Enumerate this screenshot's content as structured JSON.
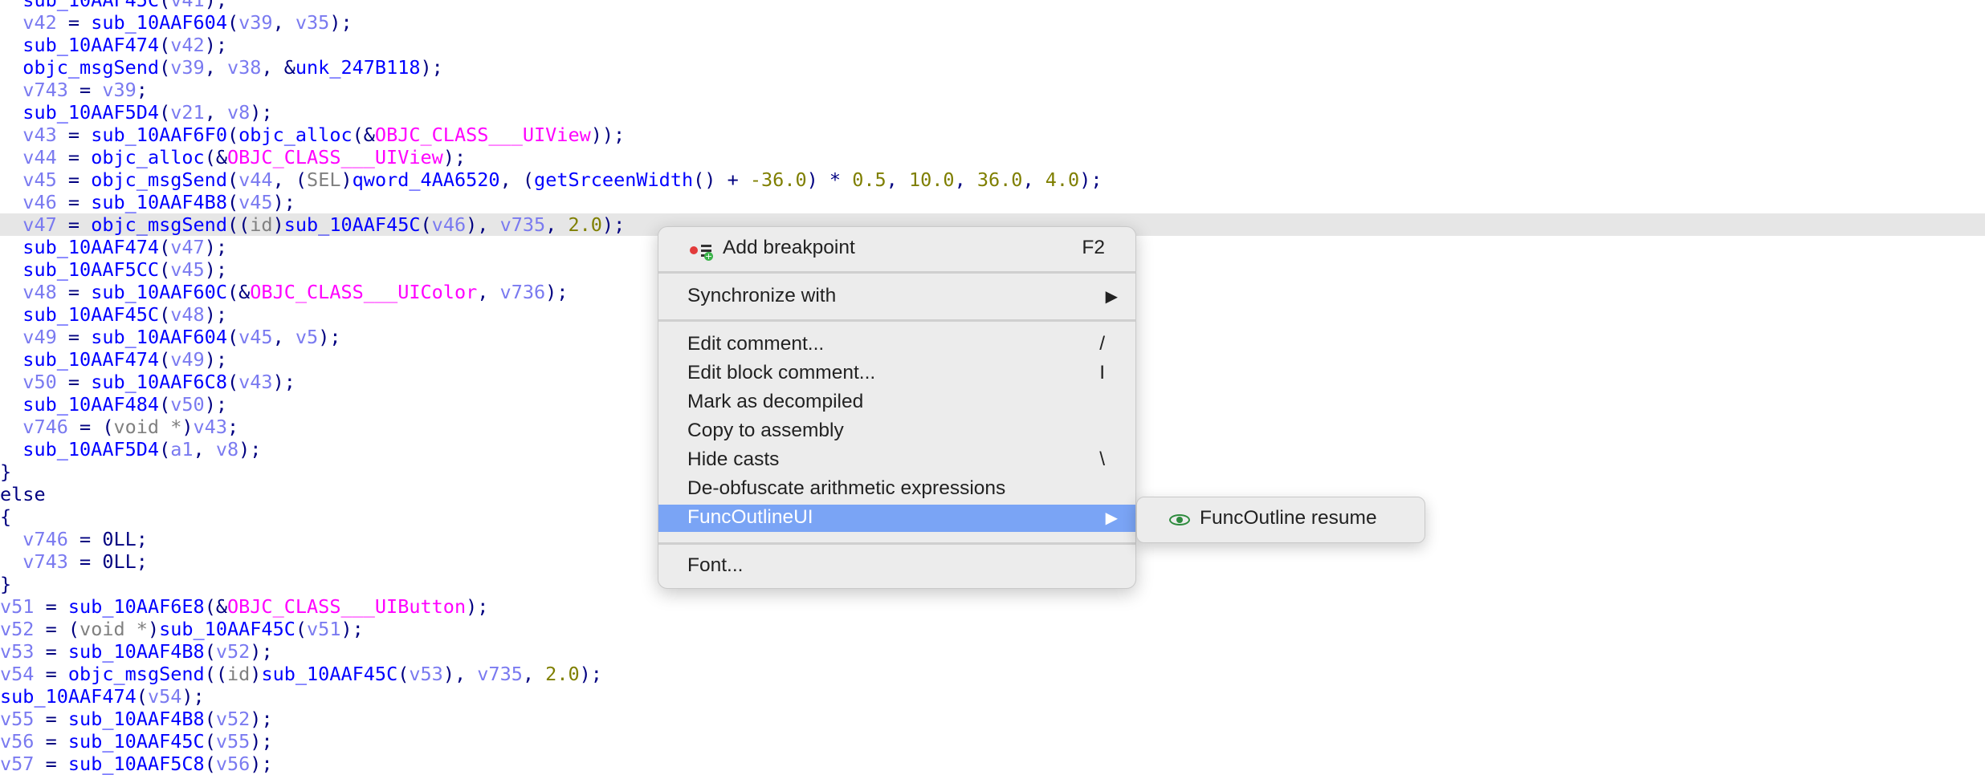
{
  "code": {
    "highlighted_line": 10,
    "lines": [
      [
        [
          "  ",
          "pun"
        ],
        [
          "sub_10AAF45C",
          "fn"
        ],
        [
          "(",
          "pun"
        ],
        [
          "v41",
          "var"
        ],
        [
          ");",
          "pun"
        ]
      ],
      [
        [
          "  ",
          "pun"
        ],
        [
          "v42",
          "var"
        ],
        [
          " = ",
          "op"
        ],
        [
          "sub_10AAF604",
          "fn"
        ],
        [
          "(",
          "pun"
        ],
        [
          "v39",
          "var"
        ],
        [
          ", ",
          "pun"
        ],
        [
          "v35",
          "var"
        ],
        [
          ");",
          "pun"
        ]
      ],
      [
        [
          "  ",
          "pun"
        ],
        [
          "sub_10AAF474",
          "fn"
        ],
        [
          "(",
          "pun"
        ],
        [
          "v42",
          "var"
        ],
        [
          ");",
          "pun"
        ]
      ],
      [
        [
          "  ",
          "pun"
        ],
        [
          "objc_msgSend",
          "fn"
        ],
        [
          "(",
          "pun"
        ],
        [
          "v39",
          "var"
        ],
        [
          ", ",
          "pun"
        ],
        [
          "v38",
          "var"
        ],
        [
          ", &",
          "pun"
        ],
        [
          "unk_247B118",
          "fn"
        ],
        [
          ");",
          "pun"
        ]
      ],
      [
        [
          "  ",
          "pun"
        ],
        [
          "v743",
          "var"
        ],
        [
          " = ",
          "op"
        ],
        [
          "v39",
          "var"
        ],
        [
          ";",
          "pun"
        ]
      ],
      [
        [
          "  ",
          "pun"
        ],
        [
          "sub_10AAF5D4",
          "fn"
        ],
        [
          "(",
          "pun"
        ],
        [
          "v21",
          "var"
        ],
        [
          ", ",
          "pun"
        ],
        [
          "v8",
          "var"
        ],
        [
          ");",
          "pun"
        ]
      ],
      [
        [
          "  ",
          "pun"
        ],
        [
          "v43",
          "var"
        ],
        [
          " = ",
          "op"
        ],
        [
          "sub_10AAF6F0",
          "fn"
        ],
        [
          "(",
          "pun"
        ],
        [
          "objc_alloc",
          "fn"
        ],
        [
          "(&",
          "pun"
        ],
        [
          "OBJC_CLASS___UIView",
          "cls"
        ],
        [
          "));",
          "pun"
        ]
      ],
      [
        [
          "  ",
          "pun"
        ],
        [
          "v44",
          "var"
        ],
        [
          " = ",
          "op"
        ],
        [
          "objc_alloc",
          "fn"
        ],
        [
          "(&",
          "pun"
        ],
        [
          "OBJC_CLASS___UIView",
          "cls"
        ],
        [
          ");",
          "pun"
        ]
      ],
      [
        [
          "  ",
          "pun"
        ],
        [
          "v45",
          "var"
        ],
        [
          " = ",
          "op"
        ],
        [
          "objc_msgSend",
          "fn"
        ],
        [
          "(",
          "pun"
        ],
        [
          "v44",
          "var"
        ],
        [
          ", (",
          "pun"
        ],
        [
          "SEL",
          "typ"
        ],
        [
          ")",
          "pun"
        ],
        [
          "qword_4AA6520",
          "fn"
        ],
        [
          ", (",
          "pun"
        ],
        [
          "getSrceenWidth",
          "fn"
        ],
        [
          "() + ",
          "pun"
        ],
        [
          "-36.0",
          "num"
        ],
        [
          ") * ",
          "pun"
        ],
        [
          "0.5",
          "num"
        ],
        [
          ", ",
          "pun"
        ],
        [
          "10.0",
          "num"
        ],
        [
          ", ",
          "pun"
        ],
        [
          "36.0",
          "num"
        ],
        [
          ", ",
          "pun"
        ],
        [
          "4.0",
          "num"
        ],
        [
          ");",
          "pun"
        ]
      ],
      [
        [
          "  ",
          "pun"
        ],
        [
          "v46",
          "var"
        ],
        [
          " = ",
          "op"
        ],
        [
          "sub_10AAF4B8",
          "fn"
        ],
        [
          "(",
          "pun"
        ],
        [
          "v45",
          "var"
        ],
        [
          ");",
          "pun"
        ]
      ],
      [
        [
          "  ",
          "pun"
        ],
        [
          "v47",
          "var"
        ],
        [
          " = ",
          "op"
        ],
        [
          "objc_msgSend",
          "fn"
        ],
        [
          "((",
          "pun"
        ],
        [
          "id",
          "typ"
        ],
        [
          ")",
          "pun"
        ],
        [
          "sub_10AAF45C",
          "fn"
        ],
        [
          "(",
          "pun"
        ],
        [
          "v46",
          "var"
        ],
        [
          "), ",
          "pun"
        ],
        [
          "v735",
          "var"
        ],
        [
          ", ",
          "pun"
        ],
        [
          "2.0",
          "num"
        ],
        [
          ");",
          "pun"
        ]
      ],
      [
        [
          "  ",
          "pun"
        ],
        [
          "sub_10AAF474",
          "fn"
        ],
        [
          "(",
          "pun"
        ],
        [
          "v47",
          "var"
        ],
        [
          ");",
          "pun"
        ]
      ],
      [
        [
          "  ",
          "pun"
        ],
        [
          "sub_10AAF5CC",
          "fn"
        ],
        [
          "(",
          "pun"
        ],
        [
          "v45",
          "var"
        ],
        [
          ");",
          "pun"
        ]
      ],
      [
        [
          "  ",
          "pun"
        ],
        [
          "v48",
          "var"
        ],
        [
          " = ",
          "op"
        ],
        [
          "sub_10AAF60C",
          "fn"
        ],
        [
          "(&",
          "pun"
        ],
        [
          "OBJC_CLASS___UIColor",
          "cls"
        ],
        [
          ", ",
          "pun"
        ],
        [
          "v736",
          "var"
        ],
        [
          ");",
          "pun"
        ]
      ],
      [
        [
          "  ",
          "pun"
        ],
        [
          "sub_10AAF45C",
          "fn"
        ],
        [
          "(",
          "pun"
        ],
        [
          "v48",
          "var"
        ],
        [
          ");",
          "pun"
        ]
      ],
      [
        [
          "  ",
          "pun"
        ],
        [
          "v49",
          "var"
        ],
        [
          " = ",
          "op"
        ],
        [
          "sub_10AAF604",
          "fn"
        ],
        [
          "(",
          "pun"
        ],
        [
          "v45",
          "var"
        ],
        [
          ", ",
          "pun"
        ],
        [
          "v5",
          "var"
        ],
        [
          ");",
          "pun"
        ]
      ],
      [
        [
          "  ",
          "pun"
        ],
        [
          "sub_10AAF474",
          "fn"
        ],
        [
          "(",
          "pun"
        ],
        [
          "v49",
          "var"
        ],
        [
          ");",
          "pun"
        ]
      ],
      [
        [
          "  ",
          "pun"
        ],
        [
          "v50",
          "var"
        ],
        [
          " = ",
          "op"
        ],
        [
          "sub_10AAF6C8",
          "fn"
        ],
        [
          "(",
          "pun"
        ],
        [
          "v43",
          "var"
        ],
        [
          ");",
          "pun"
        ]
      ],
      [
        [
          "  ",
          "pun"
        ],
        [
          "sub_10AAF484",
          "fn"
        ],
        [
          "(",
          "pun"
        ],
        [
          "v50",
          "var"
        ],
        [
          ");",
          "pun"
        ]
      ],
      [
        [
          "  ",
          "pun"
        ],
        [
          "v746",
          "var"
        ],
        [
          " = (",
          "op"
        ],
        [
          "void *",
          "typ"
        ],
        [
          ")",
          "pun"
        ],
        [
          "v43",
          "var"
        ],
        [
          ";",
          "pun"
        ]
      ],
      [
        [
          "  ",
          "pun"
        ],
        [
          "sub_10AAF5D4",
          "fn"
        ],
        [
          "(",
          "pun"
        ],
        [
          "a1",
          "var"
        ],
        [
          ", ",
          "pun"
        ],
        [
          "v8",
          "var"
        ],
        [
          ");",
          "pun"
        ]
      ],
      [
        [
          "}",
          "pun"
        ]
      ],
      [
        [
          "else",
          "kw"
        ]
      ],
      [
        [
          "{",
          "pun"
        ]
      ],
      [
        [
          "  ",
          "pun"
        ],
        [
          "v746",
          "var"
        ],
        [
          " = ",
          "op"
        ],
        [
          "0LL",
          "pun"
        ],
        [
          ";",
          "pun"
        ]
      ],
      [
        [
          "  ",
          "pun"
        ],
        [
          "v743",
          "var"
        ],
        [
          " = ",
          "op"
        ],
        [
          "0LL",
          "pun"
        ],
        [
          ";",
          "pun"
        ]
      ],
      [
        [
          "}",
          "pun"
        ]
      ],
      [
        [
          "v51",
          "var"
        ],
        [
          " = ",
          "op"
        ],
        [
          "sub_10AAF6E8",
          "fn"
        ],
        [
          "(&",
          "pun"
        ],
        [
          "OBJC_CLASS___UIButton",
          "cls"
        ],
        [
          ");",
          "pun"
        ]
      ],
      [
        [
          "v52",
          "var"
        ],
        [
          " = (",
          "op"
        ],
        [
          "void *",
          "typ"
        ],
        [
          ")",
          "pun"
        ],
        [
          "sub_10AAF45C",
          "fn"
        ],
        [
          "(",
          "pun"
        ],
        [
          "v51",
          "var"
        ],
        [
          ");",
          "pun"
        ]
      ],
      [
        [
          "v53",
          "var"
        ],
        [
          " = ",
          "op"
        ],
        [
          "sub_10AAF4B8",
          "fn"
        ],
        [
          "(",
          "pun"
        ],
        [
          "v52",
          "var"
        ],
        [
          ");",
          "pun"
        ]
      ],
      [
        [
          "v54",
          "var"
        ],
        [
          " = ",
          "op"
        ],
        [
          "objc_msgSend",
          "fn"
        ],
        [
          "((",
          "pun"
        ],
        [
          "id",
          "typ"
        ],
        [
          ")",
          "pun"
        ],
        [
          "sub_10AAF45C",
          "fn"
        ],
        [
          "(",
          "pun"
        ],
        [
          "v53",
          "var"
        ],
        [
          "), ",
          "pun"
        ],
        [
          "v735",
          "var"
        ],
        [
          ", ",
          "pun"
        ],
        [
          "2.0",
          "num"
        ],
        [
          ");",
          "pun"
        ]
      ],
      [
        [
          "sub_10AAF474",
          "fn"
        ],
        [
          "(",
          "pun"
        ],
        [
          "v54",
          "var"
        ],
        [
          ");",
          "pun"
        ]
      ],
      [
        [
          "v55",
          "var"
        ],
        [
          " = ",
          "op"
        ],
        [
          "sub_10AAF4B8",
          "fn"
        ],
        [
          "(",
          "pun"
        ],
        [
          "v52",
          "var"
        ],
        [
          ");",
          "pun"
        ]
      ],
      [
        [
          "v56",
          "var"
        ],
        [
          " = ",
          "op"
        ],
        [
          "sub_10AAF45C",
          "fn"
        ],
        [
          "(",
          "pun"
        ],
        [
          "v55",
          "var"
        ],
        [
          ");",
          "pun"
        ]
      ],
      [
        [
          "v57",
          "var"
        ],
        [
          " = ",
          "op"
        ],
        [
          "sub_10AAF5C8",
          "fn"
        ],
        [
          "(",
          "pun"
        ],
        [
          "v56",
          "var"
        ],
        [
          ");",
          "pun"
        ]
      ]
    ]
  },
  "context_menu": {
    "add_breakpoint": {
      "label": "Add breakpoint",
      "shortcut": "F2"
    },
    "synchronize_with": {
      "label": "Synchronize with",
      "arrow": "▶"
    },
    "edit_comment": {
      "label": "Edit comment...",
      "shortcut": "/"
    },
    "edit_block_comment": {
      "label": "Edit block comment...",
      "shortcut": "I"
    },
    "mark_decompiled": {
      "label": "Mark as decompiled"
    },
    "copy_to_assembly": {
      "label": "Copy to assembly"
    },
    "hide_casts": {
      "label": "Hide casts",
      "shortcut": "\\"
    },
    "deobfuscate": {
      "label": "De-obfuscate arithmetic expressions"
    },
    "funcoutline": {
      "label": "FuncOutlineUI",
      "arrow": "▶"
    },
    "font": {
      "label": "Font..."
    }
  },
  "submenu": {
    "item": {
      "label": "FuncOutline resume",
      "icon": "eye-icon"
    }
  },
  "colors": {
    "function": "#0000ff",
    "variable": "#7a7af0",
    "class": "#ff00ff",
    "number": "#7f7f00",
    "type": "#808080",
    "highlight": "#e6e6e6",
    "menu_active": "#7aa4f5"
  }
}
